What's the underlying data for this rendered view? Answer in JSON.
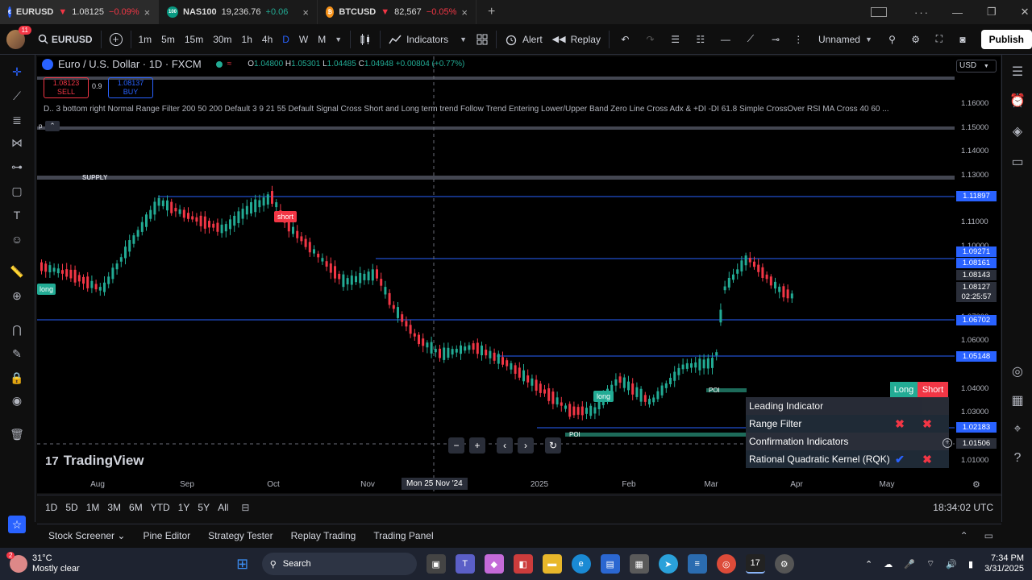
{
  "browser_tabs": [
    {
      "symbol": "EURUSD",
      "arrow": "▼",
      "price": "1.08125",
      "change": "−0.09%",
      "dir": "dn",
      "fav": "€",
      "favcolor": "#2962ff"
    },
    {
      "symbol": "NAS100",
      "arrow": "",
      "price": "19,236.76",
      "change": "+0.06",
      "dir": "up",
      "fav": "100",
      "favcolor": "#089981"
    },
    {
      "symbol": "BTCUSD",
      "arrow": "▼",
      "price": "82,567",
      "change": "−0.05%",
      "dir": "dn",
      "fav": "₿",
      "favcolor": "#f7931a"
    }
  ],
  "toolbar": {
    "avatar_badge": "11",
    "symbol": "EURUSD",
    "intervals": [
      "1m",
      "5m",
      "15m",
      "30m",
      "1h",
      "4h",
      "D",
      "W",
      "M"
    ],
    "active_interval": "D",
    "indicators": "Indicators",
    "alert": "Alert",
    "replay": "Replay",
    "layout_name": "Unnamed",
    "publish": "Publish"
  },
  "legend": {
    "title": "Euro / U.S. Dollar · 1D · FXCM",
    "o_label": "O",
    "o": "1.04800",
    "h_label": "H",
    "h": "1.05301",
    "l_label": "L",
    "l": "1.04485",
    "c_label": "C",
    "c": "1.04948",
    "change": "+0.00804 (+0.77%)",
    "sell_price": "1.08123",
    "sell_label": "SELL",
    "spread": "0.9",
    "buy_price": "1.08137",
    "buy_label": "BUY",
    "indicator_line": "D.. 3 bottom right Normal Range Filter 200 50 200 Default 3 9 21 55 Default Signal Cross Short and Long term trend Follow Trend Entering Lower/Upper Band Zero Line Cross Adx & +DI -DI 61.8 Simple CrossOver RSI MA Cross 40 60 ...",
    "p_label": "p"
  },
  "chart_labels": {
    "supply": "SUPPLY",
    "short": "short",
    "long_left": "long",
    "long_mid": "long",
    "poi1": "POI",
    "poi2": "POI",
    "watermark": "TradingView"
  },
  "price_axis": {
    "currency": "USD",
    "ticks": [
      "1.16000",
      "1.15000",
      "1.14000",
      "1.13000",
      "1.11000",
      "1.10000",
      "1.07000",
      "1.06000",
      "1.04000",
      "1.03000",
      "1.01000"
    ],
    "tags": {
      "t11897": "1.11897",
      "t09271": "1.09271",
      "t08161": "1.08161",
      "t08143": "1.08143",
      "t08127": "1.08127",
      "countdown": "02:25:57",
      "t06702": "1.06702",
      "t05148": "1.05148",
      "t02183": "1.02183",
      "t01506": "1.01506"
    },
    "colors": {
      "blue": "#2962ff",
      "gray": "#434651"
    }
  },
  "time_axis": {
    "labels": [
      "Aug",
      "Sep",
      "Oct",
      "Nov",
      "2025",
      "Feb",
      "Mar",
      "Apr",
      "May"
    ],
    "crosshair": "Mon 25 Nov '24"
  },
  "signal_panel": {
    "long": "Long",
    "short": "Short",
    "leading": "Leading Indicator",
    "range_filter": "Range Filter",
    "confirmation": "Confirmation Indicators",
    "rqk": "Rational Quadratic Kernel (RQK)",
    "check": "✔",
    "cross": "✖"
  },
  "range_bar": {
    "ranges": [
      "1D",
      "5D",
      "1M",
      "3M",
      "6M",
      "YTD",
      "1Y",
      "5Y",
      "All"
    ],
    "clock": "18:34:02 UTC"
  },
  "bottom_panel": {
    "tabs": [
      "Stock Screener",
      "Pine Editor",
      "Strategy Tester",
      "Replay Trading",
      "Trading Panel"
    ]
  },
  "taskbar": {
    "temp": "31°C",
    "weather": "Mostly clear",
    "weather_badge": "2",
    "search": "Search",
    "time": "7:34 PM",
    "date": "3/31/2025"
  }
}
